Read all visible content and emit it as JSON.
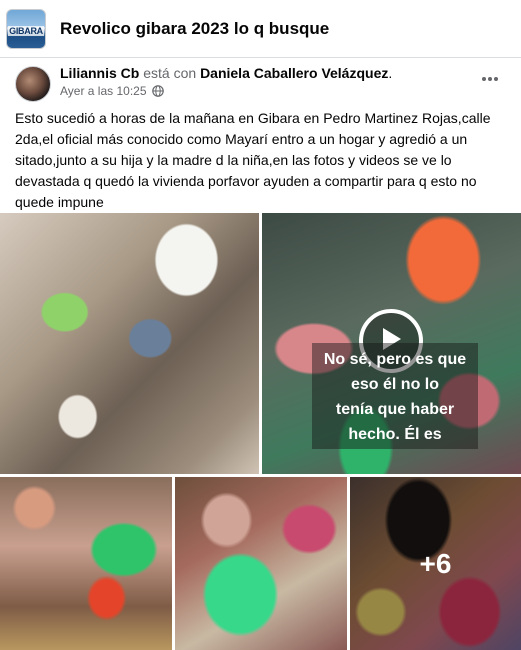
{
  "group": {
    "title": "Revolico gibara 2023 lo q busque",
    "thumb_text": "GIBARA"
  },
  "post": {
    "author": "Liliannis Cb",
    "with_text": "está con",
    "tagged": "Daniela Caballero Velázquez",
    "tagged_suffix": ".",
    "timestamp": "Ayer a las 10:25",
    "privacy_icon": "globe-icon",
    "more_icon": "more-dots-icon",
    "text": "Esto sucedió a horas de la mañana en Gibara en Pedro Martinez Rojas,calle 2da,el oficial más conocido como Mayarí entro a un hogar y agredió a un sitado,junto a su hija y la madre d la niña,en las fotos y videos se ve lo devastada q quedó la vivienda porfavor ayuden a compartir para q esto no quede impune"
  },
  "media": {
    "video_caption": [
      "No sé, pero es que",
      "eso él no lo",
      "tenía que haber",
      "hecho. Él es"
    ],
    "more_photos": "+6",
    "play_icon": "play-icon"
  },
  "colors": {
    "header_bg": "#ffffff",
    "page_bg": "#f0f2f5",
    "text_primary": "#050505",
    "text_secondary": "#65676b"
  }
}
